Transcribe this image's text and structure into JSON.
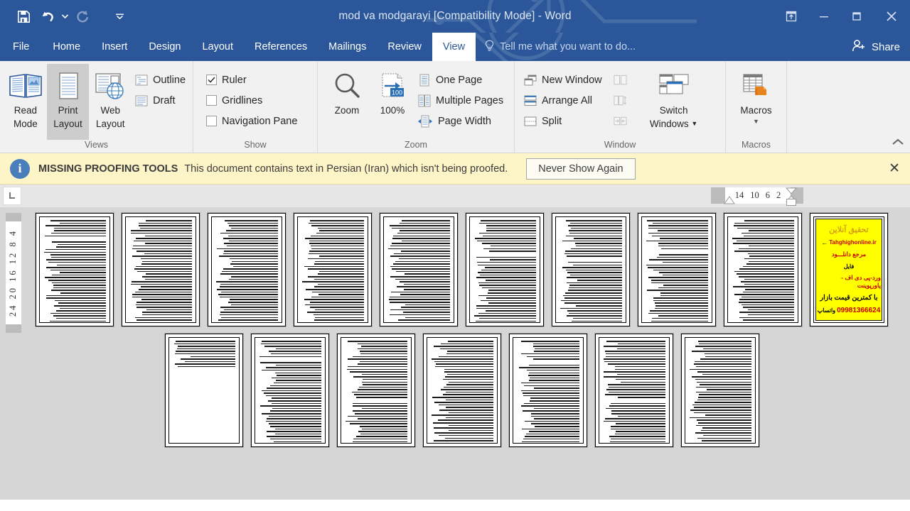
{
  "window": {
    "title": "mod va modgarayi [Compatibility Mode] - Word",
    "quick_access": [
      {
        "name": "save-button",
        "icon": "save-icon",
        "enabled": true
      },
      {
        "name": "undo-button",
        "icon": "undo-icon",
        "enabled": true
      },
      {
        "name": "redo-button",
        "icon": "redo-icon",
        "enabled": false
      },
      {
        "name": "customize-quick-access-button",
        "icon": "chevron-down-icon",
        "enabled": true
      }
    ],
    "buttons": {
      "ribbon_display_options": "ribbon-display-options-icon",
      "minimize": "minimize-icon",
      "restore": "restore-icon",
      "close": "close-icon"
    }
  },
  "tabs": [
    {
      "label": "File",
      "active": false
    },
    {
      "label": "Home",
      "active": false
    },
    {
      "label": "Insert",
      "active": false
    },
    {
      "label": "Design",
      "active": false
    },
    {
      "label": "Layout",
      "active": false
    },
    {
      "label": "References",
      "active": false
    },
    {
      "label": "Mailings",
      "active": false
    },
    {
      "label": "Review",
      "active": false
    },
    {
      "label": "View",
      "active": true
    }
  ],
  "tell_me": "Tell me what you want to do...",
  "share": "Share",
  "ribbon": {
    "views": {
      "title": "Views",
      "read_mode": "Read\nMode",
      "read_mode_line1": "Read",
      "read_mode_line2": "Mode",
      "print_layout_line1": "Print",
      "print_layout_line2": "Layout",
      "web_layout_line1": "Web",
      "web_layout_line2": "Layout",
      "outline": "Outline",
      "draft": "Draft"
    },
    "show": {
      "title": "Show",
      "ruler": "Ruler",
      "ruler_checked": true,
      "gridlines": "Gridlines",
      "gridlines_checked": false,
      "navigation_pane": "Navigation Pane",
      "navigation_pane_checked": false
    },
    "zoom": {
      "title": "Zoom",
      "zoom_button": "Zoom",
      "percent_button": "100%",
      "percent_badge": "100",
      "one_page": "One Page",
      "multiple_pages": "Multiple Pages",
      "page_width": "Page Width"
    },
    "window": {
      "title": "Window",
      "new_window": "New Window",
      "arrange_all": "Arrange All",
      "split": "Split",
      "switch_windows_line1": "Switch",
      "switch_windows_line2": "Windows",
      "view_side_by_side": "view-side-by-side-icon",
      "synchronous_scrolling": "synchronous-scrolling-icon",
      "reset_window_position": "reset-window-position-icon"
    },
    "macros": {
      "title": "Macros",
      "macros_button": "Macros"
    },
    "collapse_ribbon": "collapse-ribbon-icon"
  },
  "notification": {
    "icon": "info-icon",
    "title": "MISSING PROOFING TOOLS",
    "message": "This document contains text in Persian (Iran) which isn't being proofed.",
    "action_label": "Never Show Again",
    "close_label": "✕"
  },
  "ruler": {
    "tab_stop_selector": "left-tab-stop-icon",
    "horizontal_marks": [
      "14",
      "10",
      "6",
      "2"
    ],
    "vertical_marks": "24  20  16  12   8   4"
  },
  "document": {
    "zoom_level": "100%",
    "row1_page_count": 10,
    "row2_page_count": 7,
    "ad_page_index": 9,
    "ad": {
      "heading": "تحقیق آنلاین",
      "url": "Tahghighonline.ir",
      "line_marja": "مرجع دانلـــود",
      "line_file": "فایل",
      "line_formats": "ورد-پی دی اف - پاورپوینت",
      "line_price": "با کمترین قیمت بازار",
      "phone": "09981366624",
      "whatsapp": "واتساپ"
    }
  },
  "colors": {
    "title_bar": "#2b579a",
    "ribbon_bg": "#f1f1f1",
    "notice_bg": "#fdf4c7",
    "doc_bg": "#d6d6d6",
    "accent": "#2b579a",
    "ad_bg": "#ffff00",
    "ad_red": "#cc0000"
  }
}
